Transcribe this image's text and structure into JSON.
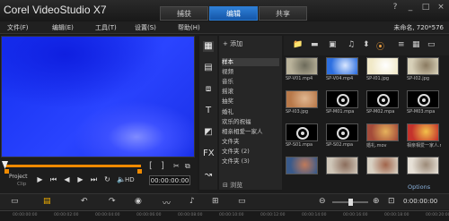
{
  "app": {
    "title": "Corel VideoStudio X7"
  },
  "tabs": [
    {
      "label": "捕获",
      "active": false
    },
    {
      "label": "编辑",
      "active": true
    },
    {
      "label": "共享",
      "active": false
    }
  ],
  "window_controls": {
    "help": "?",
    "minimize": "_",
    "maximize": "□",
    "close": "×"
  },
  "menu": {
    "items": [
      "文件(F)",
      "编辑(E)",
      "工具(T)",
      "设置(S)",
      "帮助(H)"
    ],
    "project_info": "未命名, 720*576"
  },
  "player": {
    "mode_project": "Project",
    "mode_clip": "Clip",
    "hd_label": "HD",
    "timecode": "00:00:00:00",
    "brackets": [
      "[",
      "]"
    ],
    "progress": 1.0
  },
  "library": {
    "add_label": "添加",
    "folders": [
      "样本",
      "视频",
      "音乐",
      "摇滚",
      "抽奖",
      "婚礼",
      "欢乐的祝福",
      "相亲相爱一家人",
      "文件夹",
      "文件夹 (2)",
      "文件夹 (3)"
    ],
    "active_folder": "样本",
    "browse_label": "浏览"
  },
  "media": {
    "items": [
      {
        "caption": "SP-V01.mp4",
        "type": "video",
        "bg": "#b9b29a",
        "accent": "#6c6a5a"
      },
      {
        "caption": "SP-V04.mp4",
        "type": "video",
        "bg": "#2d6fe0",
        "accent": "#d9e7ff"
      },
      {
        "caption": "SP-I01.jpg",
        "type": "image",
        "bg": "#f1e9c8",
        "accent": "#ffffff"
      },
      {
        "caption": "SP-I02.jpg",
        "type": "image",
        "bg": "#d7d0b8",
        "accent": "#8a7a60"
      },
      {
        "caption": "SP-I03.jpg",
        "type": "image",
        "bg": "#b8794a",
        "accent": "#e0b690"
      },
      {
        "caption": "SP-M01.mpa",
        "type": "audio",
        "bg": "#000000",
        "accent": "#dddddd"
      },
      {
        "caption": "SP-M02.mpa",
        "type": "audio",
        "bg": "#000000",
        "accent": "#dddddd"
      },
      {
        "caption": "SP-M03.mpa",
        "type": "audio",
        "bg": "#000000",
        "accent": "#dddddd"
      },
      {
        "caption": "SP-S01.mpa",
        "type": "audio",
        "bg": "#000000",
        "accent": "#dddddd"
      },
      {
        "caption": "SP-S02.mpa",
        "type": "audio",
        "bg": "#000000",
        "accent": "#dddddd"
      },
      {
        "caption": "婚礼.mov",
        "type": "video",
        "bg": "#a44b3a",
        "accent": "#e6b25c"
      },
      {
        "caption": "相亲相爱一家人.mpg",
        "type": "video",
        "bg": "#c4332c",
        "accent": "#f3c14a"
      },
      {
        "caption": "",
        "type": "video",
        "bg": "#3a5a8a",
        "accent": "#c07a5a"
      },
      {
        "caption": "",
        "type": "image",
        "bg": "#cfc6b8",
        "accent": "#8b6d5c"
      },
      {
        "caption": "",
        "type": "image",
        "bg": "#d8d0c2",
        "accent": "#a1654b"
      },
      {
        "caption": "",
        "type": "video",
        "bg": "#e6e0d6",
        "accent": "#9c8a78"
      }
    ],
    "options_label": "Options"
  },
  "timeline": {
    "timecode": "0:00:00:00",
    "ruler": [
      "00:00:00:00",
      "00:00:02:00",
      "00:00:04:00",
      "00:00:06:00",
      "00:00:08:00",
      "00:00:10:00",
      "00:00:12:00",
      "00:00:14:00",
      "00:00:16:00",
      "00:00:18:00",
      "00:00:20:00"
    ]
  }
}
